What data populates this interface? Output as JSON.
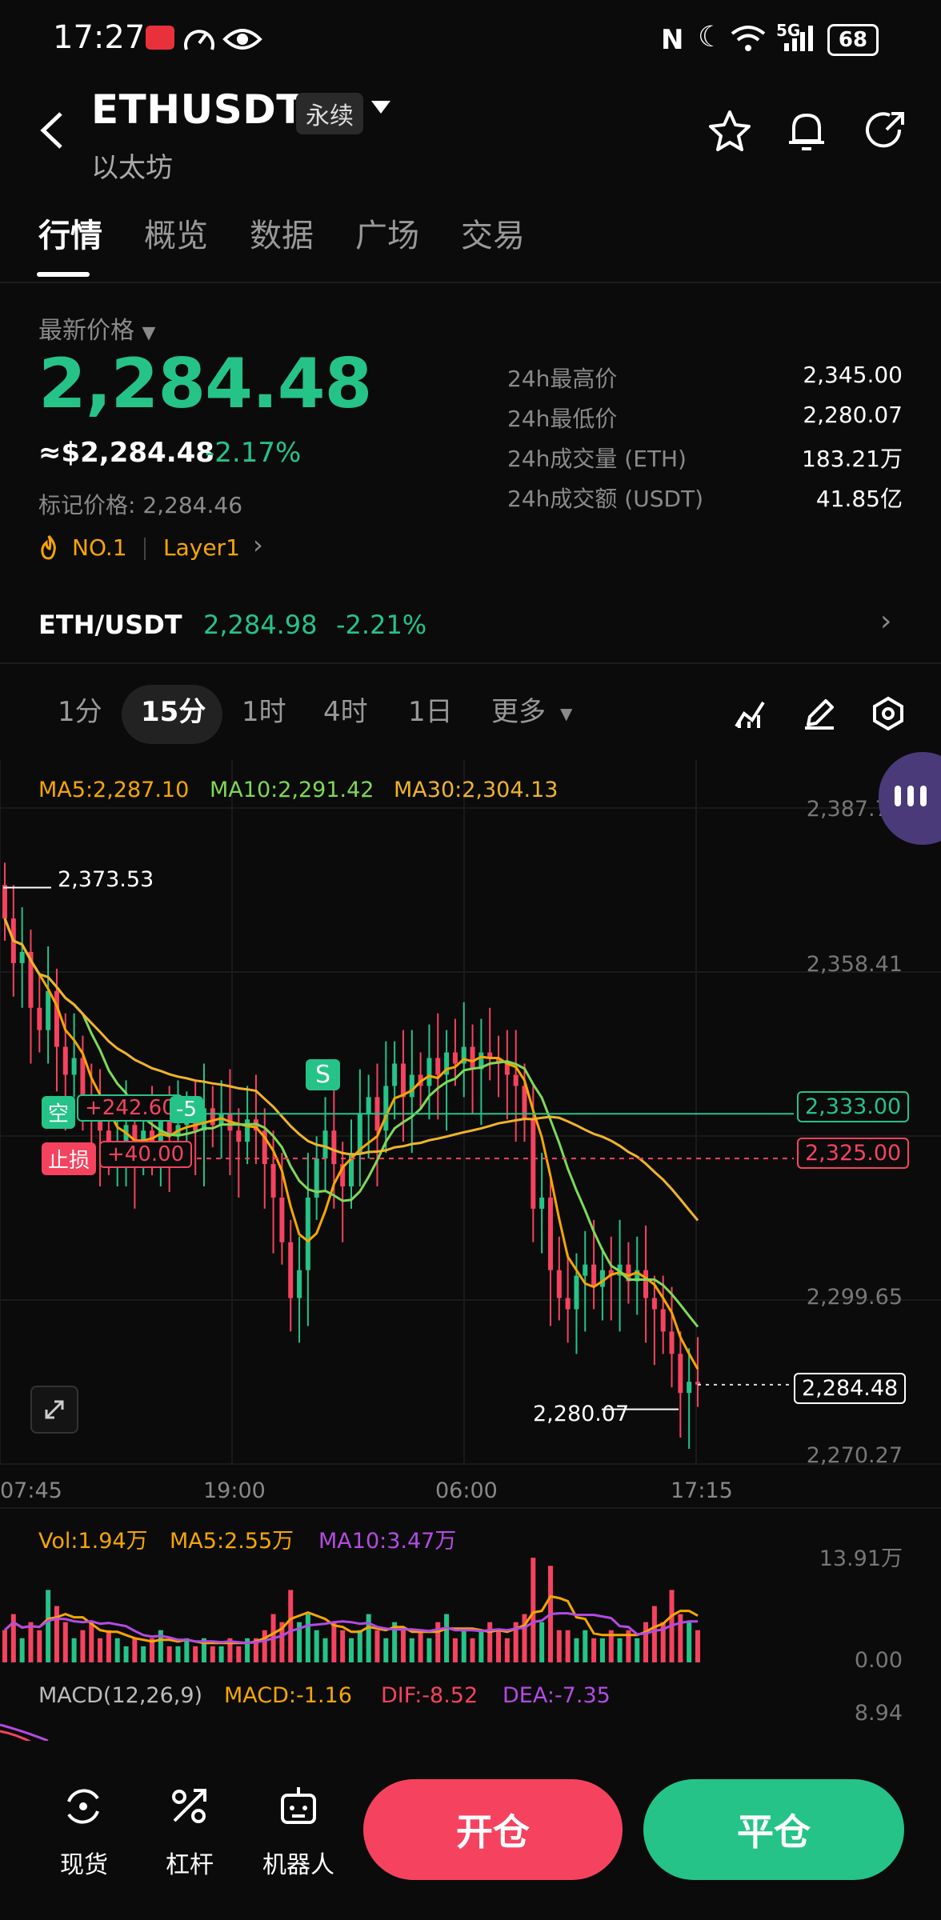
{
  "status_bar": {
    "time": "17:27",
    "battery": "68",
    "network": "5G"
  },
  "header": {
    "symbol": "ETHUSDT",
    "contract_type": "永续",
    "name": "以太坊"
  },
  "tabs": [
    {
      "label": "行情",
      "active": true
    },
    {
      "label": "概览",
      "active": false
    },
    {
      "label": "数据",
      "active": false
    },
    {
      "label": "广场",
      "active": false
    },
    {
      "label": "交易",
      "active": false
    }
  ],
  "price": {
    "label": "最新价格",
    "last": "2,284.48",
    "usd": "≈$2,284.48",
    "change": "-2.17%",
    "mark_label": "标记价格: 2,284.46",
    "rank": "NO.1",
    "tag": "Layer1"
  },
  "stats": [
    {
      "label": "24h最高价",
      "value": "2,345.00"
    },
    {
      "label": "24h最低价",
      "value": "2,280.07"
    },
    {
      "label": "24h成交量 (ETH)",
      "value": "183.21万"
    },
    {
      "label": "24h成交额 (USDT)",
      "value": "41.85亿"
    }
  ],
  "spot_row": {
    "pair": "ETH/USDT",
    "price": "2,284.98",
    "change": "-2.21%"
  },
  "timeframes": [
    {
      "label": "1分",
      "active": false
    },
    {
      "label": "15分",
      "active": true
    },
    {
      "label": "1时",
      "active": false
    },
    {
      "label": "4时",
      "active": false
    },
    {
      "label": "1日",
      "active": false
    },
    {
      "label": "更多",
      "active": false
    }
  ],
  "ma": {
    "ma5": "MA5:2,287.10",
    "ma10": "MA10:2,291.42",
    "ma30": "MA30:2,304.13"
  },
  "colors": {
    "up": "#25c388",
    "down": "#f5435f",
    "ma5": "#f7a600",
    "ma10": "#7ed957",
    "ma30": "#f0b429",
    "vol_ma10": "#b44be3"
  },
  "chart_data": {
    "type": "candlestick",
    "y_axis_labels": [
      "2,387.79",
      "2,358.41",
      "2,299.65",
      "2,270.27"
    ],
    "x_axis_labels": [
      "07:45",
      "19:00",
      "06:00",
      "17:15"
    ],
    "high_marker": "2,373.53",
    "low_marker": "2,280.07",
    "current_price_tag": "2,284.48",
    "position": {
      "side": "空",
      "pnl": "+242.60",
      "qty": "-5",
      "entry": "2,333.00"
    },
    "stop_loss": {
      "label": "止损",
      "pnl": "+40.00",
      "price": "2,325.00"
    },
    "signal": "S",
    "close": [
      2368,
      2360,
      2362,
      2352,
      2348,
      2355,
      2345,
      2340,
      2343,
      2336,
      2333,
      2330,
      2326,
      2328,
      2331,
      2326,
      2330,
      2328,
      2332,
      2329,
      2331,
      2333,
      2330,
      2334,
      2331,
      2333,
      2330,
      2328,
      2332,
      2330,
      2324,
      2318,
      2310,
      2300,
      2305,
      2318,
      2325,
      2330,
      2324,
      2320,
      2326,
      2333,
      2336,
      2330,
      2338,
      2342,
      2336,
      2340,
      2338,
      2343,
      2340,
      2344,
      2342,
      2345,
      2341,
      2344,
      2343,
      2342,
      2340,
      2338,
      2332,
      2316,
      2318,
      2305,
      2300,
      2298,
      2304,
      2306,
      2302,
      2305,
      2304,
      2306,
      2303,
      2305,
      2300,
      2298,
      2294,
      2290,
      2283,
      2285,
      2284.5
    ]
  },
  "volume": {
    "vol": "Vol:1.94万",
    "ma5": "MA5:2.55万",
    "ma10": "MA10:3.47万",
    "max_label": "13.91万",
    "min_label": "0.00",
    "values": [
      4,
      6,
      3,
      5,
      4,
      9,
      7,
      5,
      3,
      4,
      5,
      3,
      4,
      3,
      2,
      3,
      2,
      3,
      4,
      2,
      2,
      3,
      2,
      3,
      2,
      2,
      3,
      2,
      3,
      3,
      4,
      6,
      5,
      9,
      5,
      6,
      4,
      3,
      5,
      4,
      3,
      4,
      6,
      4,
      3,
      5,
      4,
      3,
      4,
      3,
      5,
      6,
      3,
      4,
      3,
      4,
      5,
      4,
      3,
      5,
      6,
      13,
      5,
      12,
      4,
      4,
      3,
      4,
      3,
      3,
      4,
      3,
      4,
      3,
      5,
      7,
      5,
      9,
      6,
      5,
      4
    ]
  },
  "macd": {
    "params": "MACD(12,26,9)",
    "macd": "MACD:-1.16",
    "dif": "DIF:-8.52",
    "dea": "DEA:-7.35",
    "axis_top": "8.94"
  },
  "bottom_nav": [
    {
      "label": "现货",
      "icon": "swap-circle-icon"
    },
    {
      "label": "杠杆",
      "icon": "leverage-icon"
    },
    {
      "label": "机器人",
      "icon": "robot-icon"
    }
  ],
  "actions": {
    "open": "开仓",
    "close": "平仓"
  }
}
